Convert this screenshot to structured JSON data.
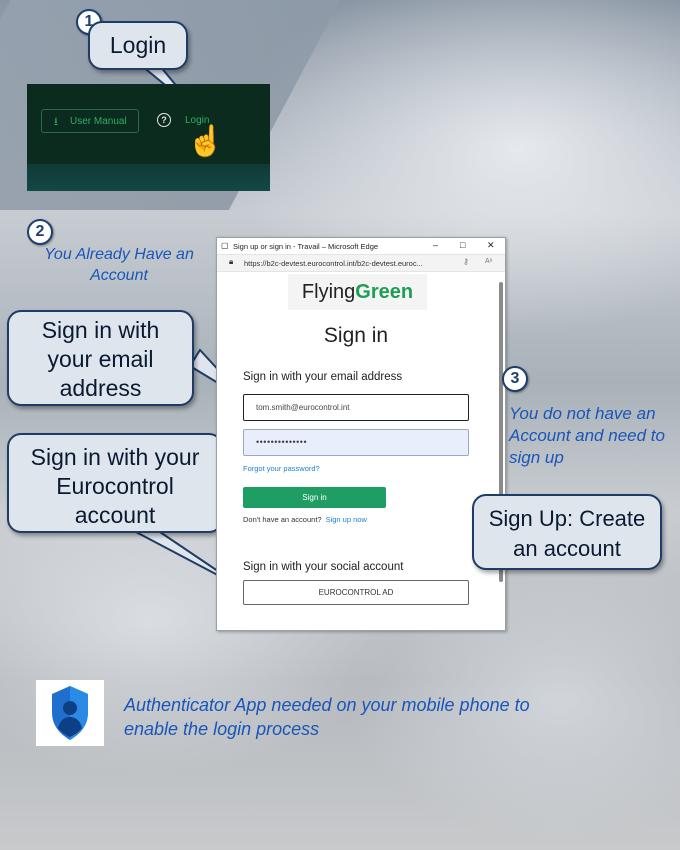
{
  "steps": {
    "one": "1",
    "two": "2",
    "three": "3"
  },
  "callouts": {
    "login": "Login",
    "email": "Sign in with your email address",
    "eurocontrol": "Sign in with your Eurocontrol account",
    "signup": "Sign Up: Create an account"
  },
  "notes": {
    "already_have": "You Already  Have an Account",
    "no_account": "You do not have an Account and need to sign up",
    "authenticator": "Authenticator App needed on your mobile phone to enable the login process"
  },
  "header": {
    "user_manual": "User Manual",
    "login": "Login"
  },
  "browser": {
    "title": "Sign up or sign in - Travail – Microsoft Edge",
    "min": "–",
    "max": "□",
    "close": "✕",
    "url": "https://b2c-devtest.eurocontrol.int/b2c-devtest.euroc..."
  },
  "signin": {
    "logo_flying": "Flying",
    "logo_green": "Green",
    "title": "Sign in",
    "email_heading": "Sign in with your email address",
    "email_value": "tom.smith@eurocontrol.int",
    "password_value": "••••••••••••••",
    "forgot": "Forgot your password?",
    "button": "Sign in",
    "no_account": "Don't have an account?",
    "signup_link": "Sign up now",
    "social_heading": "Sign in with your social account",
    "social_button": "EUROCONTROL AD"
  },
  "colors": {
    "brand_green": "#1e9e62",
    "callout_border": "#1f3c66",
    "note_blue": "#1a56b8"
  }
}
